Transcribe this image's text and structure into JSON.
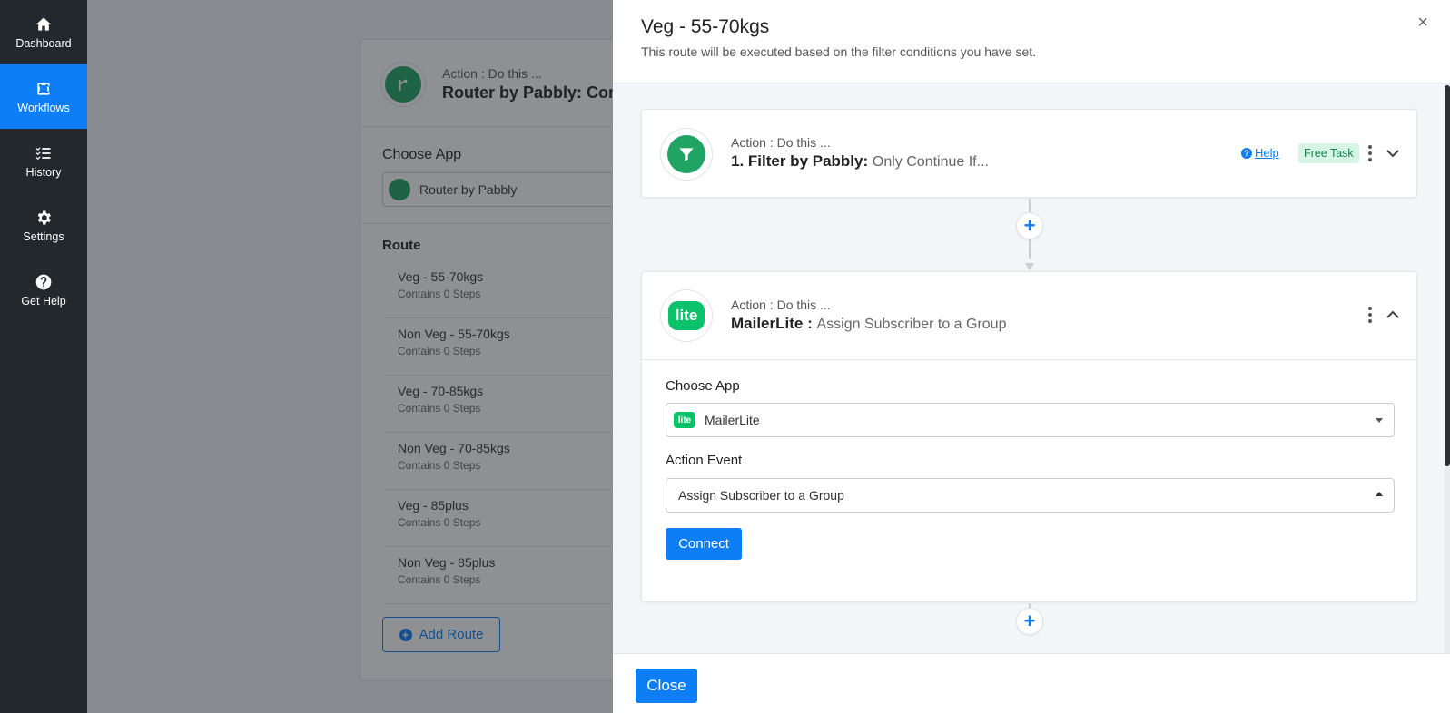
{
  "sidebar": {
    "items": [
      {
        "label": "Dashboard"
      },
      {
        "label": "Workflows"
      },
      {
        "label": "History"
      },
      {
        "label": "Settings"
      },
      {
        "label": "Get Help"
      }
    ],
    "active": "Workflows"
  },
  "background": {
    "action_sub": "Action : Do this ...",
    "action_title": "Router by Pabbly: Cond",
    "choose_app_label": "Choose App",
    "choose_app_value": "Router by Pabbly",
    "route_label": "Route",
    "routes": [
      {
        "name": "Veg - 55-70kgs",
        "steps": "Contains 0 Steps"
      },
      {
        "name": "Non Veg - 55-70kgs",
        "steps": "Contains 0 Steps"
      },
      {
        "name": "Veg - 70-85kgs",
        "steps": "Contains 0 Steps"
      },
      {
        "name": "Non Veg - 70-85kgs",
        "steps": "Contains 0 Steps"
      },
      {
        "name": "Veg - 85plus",
        "steps": "Contains 0 Steps"
      },
      {
        "name": "Non Veg - 85plus",
        "steps": "Contains 0 Steps"
      }
    ],
    "add_route_label": "Add Route"
  },
  "modal": {
    "title": "Veg - 55-70kgs",
    "subtitle": "This route will be executed based on the filter conditions you have set.",
    "close_icon": "×",
    "step1": {
      "sub": "Action : Do this ...",
      "title": "1. Filter by Pabbly:",
      "desc": "Only Continue If...",
      "help_label": "Help",
      "badge": "Free Task"
    },
    "step2": {
      "sub": "Action : Do this ...",
      "title": "MailerLite :",
      "desc": "Assign Subscriber to a Group",
      "icon_text": "lite",
      "choose_app_label": "Choose App",
      "choose_app_value": "MailerLite",
      "choose_app_icon_text": "lite",
      "action_event_label": "Action Event",
      "action_event_value": "Assign Subscriber to a Group",
      "connect_label": "Connect"
    },
    "plus_symbol": "+",
    "footer_close_label": "Close"
  },
  "colors": {
    "accent": "#0d7ef5",
    "sidebar": "#23282d",
    "filter_green": "#1fa463",
    "mailerlite_green": "#09c269",
    "badge_bg": "#d6f5e4",
    "badge_text": "#17844f"
  }
}
